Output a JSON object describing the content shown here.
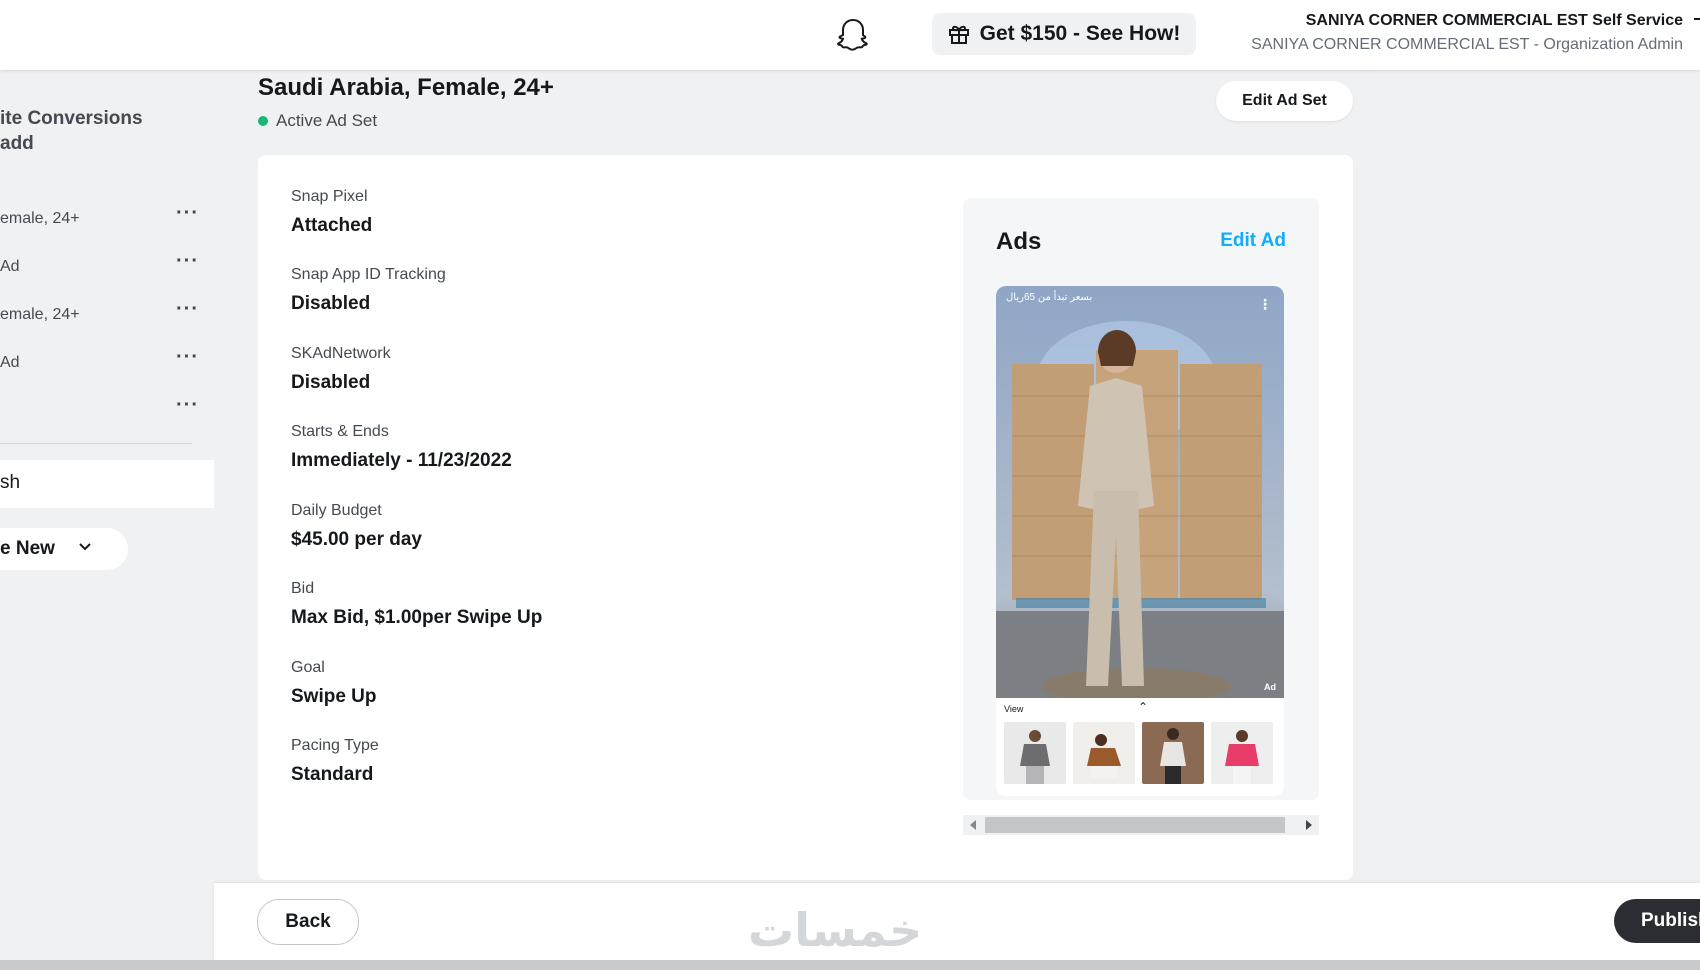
{
  "header": {
    "promo_label": "Get $150 - See How!",
    "org_name": "SANIYA CORNER COMMERCIAL EST Self Service",
    "org_role": "SANIYA CORNER COMMERCIAL EST - Organization Admin"
  },
  "sidebar": {
    "campaign_line1": "ite Conversions",
    "campaign_line2": "add",
    "items": [
      {
        "label": "emale, 24+"
      },
      {
        "label": "Ad"
      },
      {
        "label": "emale, 24+"
      },
      {
        "label": "Ad"
      },
      {
        "label": ""
      }
    ],
    "more_glyph": "···",
    "active_label": "sh",
    "new_label": "e New"
  },
  "adset": {
    "title": "Saudi Arabia, Female, 24+",
    "status": "Active Ad Set",
    "edit_label": "Edit Ad Set"
  },
  "details": [
    {
      "key": "Snap Pixel",
      "value": "Attached"
    },
    {
      "key": "Snap App ID Tracking",
      "value": "Disabled"
    },
    {
      "key": "SKAdNetwork",
      "value": "Disabled"
    },
    {
      "key": "Starts & Ends",
      "value": "Immediately - 11/23/2022"
    },
    {
      "key": "Daily Budget",
      "value": "$45.00 per day"
    },
    {
      "key": "Bid",
      "value": "Max Bid, $1.00per Swipe Up"
    },
    {
      "key": "Goal",
      "value": "Swipe Up"
    },
    {
      "key": "Pacing Type",
      "value": "Standard"
    }
  ],
  "ads": {
    "title": "Ads",
    "edit_label": "Edit Ad",
    "preview": {
      "top_text": "بسعر تبدأ من 65ريال",
      "menu_glyph": "⋮",
      "ad_badge": "Ad",
      "view_label": "View",
      "view_caret": "⌃"
    }
  },
  "footer": {
    "back_label": "Back",
    "publish_label": "Publish",
    "watermark": "خمسات"
  },
  "colors": {
    "accent_link": "#0fadff",
    "status_active": "#17b874",
    "dark_button": "#2a2d31"
  }
}
